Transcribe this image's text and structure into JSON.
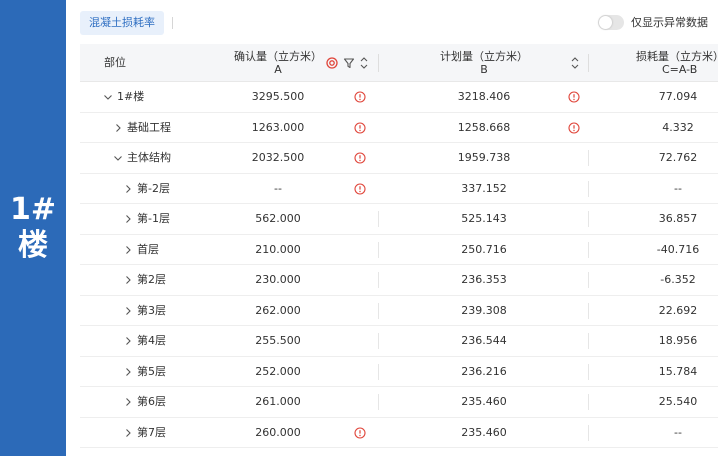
{
  "side_label": "1#楼",
  "toolbar": {
    "tab_label": "混凝土损耗率",
    "toggle_label": "仅显示异常数据",
    "toggle_on": false
  },
  "colors": {
    "banner": "#2c6ab8",
    "accent": "#2f6fc2",
    "warning": "#e0453a"
  },
  "columns": {
    "part": "部位",
    "confirmed": {
      "title": "确认量（立方米）",
      "sub": "A"
    },
    "planned": {
      "title": "计划量（立方米）",
      "sub": "B"
    },
    "loss": {
      "title": "损耗量（立方米）",
      "sub": "C=A-B"
    }
  },
  "rows": [
    {
      "name": "1#楼",
      "level": 0,
      "expanded": true,
      "confirmed": "3295.500",
      "confirmed_warn": true,
      "planned": "3218.406",
      "planned_warn": true,
      "loss": "77.094"
    },
    {
      "name": "基础工程",
      "level": 1,
      "expanded": false,
      "confirmed": "1263.000",
      "confirmed_warn": true,
      "planned": "1258.668",
      "planned_warn": true,
      "loss": "4.332"
    },
    {
      "name": "主体结构",
      "level": 1,
      "expanded": true,
      "confirmed": "2032.500",
      "confirmed_warn": true,
      "planned": "1959.738",
      "planned_warn": false,
      "loss": "72.762"
    },
    {
      "name": "第-2层",
      "level": 2,
      "expanded": false,
      "confirmed": "--",
      "confirmed_warn": true,
      "planned": "337.152",
      "planned_warn": false,
      "loss": "--"
    },
    {
      "name": "第-1层",
      "level": 2,
      "expanded": false,
      "confirmed": "562.000",
      "confirmed_warn": false,
      "planned": "525.143",
      "planned_warn": false,
      "loss": "36.857"
    },
    {
      "name": "首层",
      "level": 2,
      "expanded": false,
      "confirmed": "210.000",
      "confirmed_warn": false,
      "planned": "250.716",
      "planned_warn": false,
      "loss": "-40.716"
    },
    {
      "name": "第2层",
      "level": 2,
      "expanded": false,
      "confirmed": "230.000",
      "confirmed_warn": false,
      "planned": "236.353",
      "planned_warn": false,
      "loss": "-6.352"
    },
    {
      "name": "第3层",
      "level": 2,
      "expanded": false,
      "confirmed": "262.000",
      "confirmed_warn": false,
      "planned": "239.308",
      "planned_warn": false,
      "loss": "22.692"
    },
    {
      "name": "第4层",
      "level": 2,
      "expanded": false,
      "confirmed": "255.500",
      "confirmed_warn": false,
      "planned": "236.544",
      "planned_warn": false,
      "loss": "18.956"
    },
    {
      "name": "第5层",
      "level": 2,
      "expanded": false,
      "confirmed": "252.000",
      "confirmed_warn": false,
      "planned": "236.216",
      "planned_warn": false,
      "loss": "15.784"
    },
    {
      "name": "第6层",
      "level": 2,
      "expanded": false,
      "confirmed": "261.000",
      "confirmed_warn": false,
      "planned": "235.460",
      "planned_warn": false,
      "loss": "25.540"
    },
    {
      "name": "第7层",
      "level": 2,
      "expanded": false,
      "confirmed": "260.000",
      "confirmed_warn": true,
      "planned": "235.460",
      "planned_warn": false,
      "loss": "--"
    }
  ]
}
